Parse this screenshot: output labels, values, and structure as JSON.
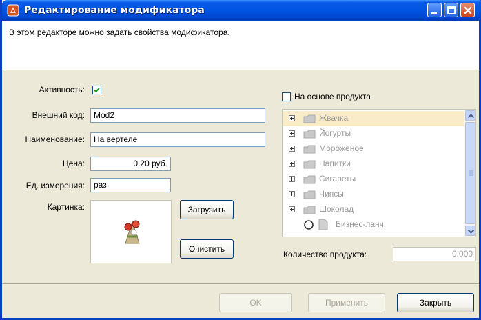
{
  "window": {
    "title": "Редактирование модификатора",
    "colors": {
      "titlebar": "#0054e3",
      "face": "#ece9d8",
      "accent_orange": "#c84c1f"
    }
  },
  "description": "В этом редакторе можно задать свойства модификатора.",
  "form": {
    "active_label": "Активность:",
    "active_checked": true,
    "external_code_label": "Внешний код:",
    "external_code_value": "Mod2",
    "name_label": "Наименование:",
    "name_value": "На вертеле",
    "price_label": "Цена:",
    "price_value": "0.20 руб.",
    "unit_label": "Ед. измерения:",
    "unit_value": "раз",
    "picture_label": "Картинка:",
    "load_button": "Загрузить",
    "clear_button": "Очистить"
  },
  "product": {
    "based_on_label": "На основе продукта",
    "based_on_checked": false,
    "tree_items": [
      {
        "label": "Жвачка",
        "type": "folder",
        "selected": true
      },
      {
        "label": "Йогурты",
        "type": "folder"
      },
      {
        "label": "Мороженое",
        "type": "folder"
      },
      {
        "label": "Напитки",
        "type": "folder"
      },
      {
        "label": "Сигареты",
        "type": "folder"
      },
      {
        "label": "Чипсы",
        "type": "folder"
      },
      {
        "label": "Шоколад",
        "type": "folder"
      },
      {
        "label": "Бизнес-ланч",
        "type": "item"
      }
    ],
    "quantity_label": "Количество продукта:",
    "quantity_value": "0.000"
  },
  "footer": {
    "ok_button": "OK",
    "apply_button": "Применить",
    "close_button": "Закрыть"
  }
}
